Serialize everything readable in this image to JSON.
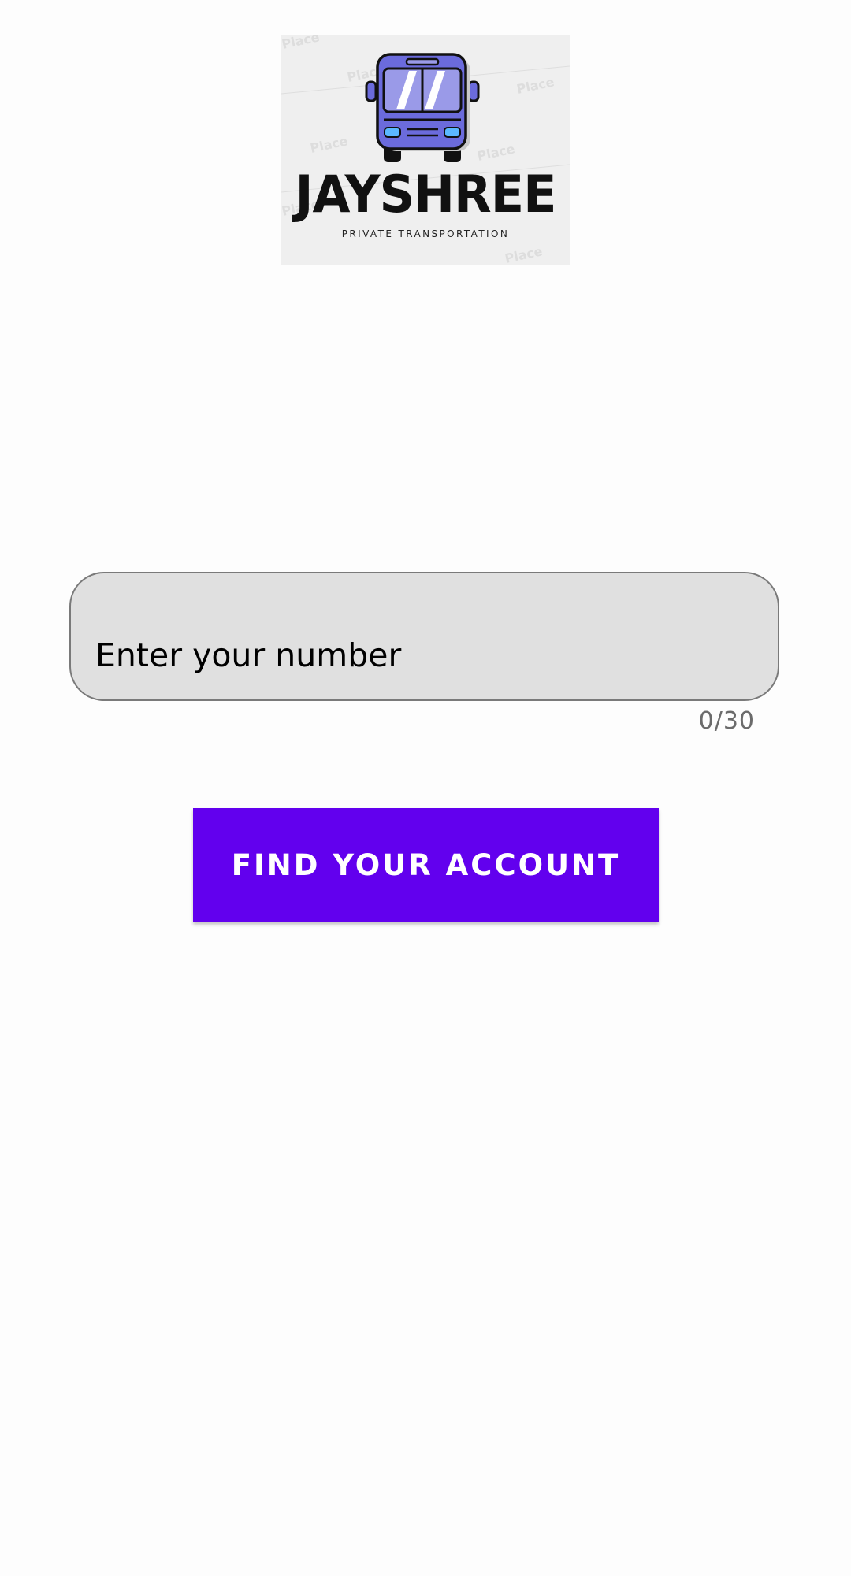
{
  "logo": {
    "brand_name": "JAYSHREE",
    "tagline": "PRIVATE TRANSPORTATION",
    "watermark_text": "Place",
    "icon": "bus-icon",
    "bus_body_color": "#6b6bdc",
    "bus_window_color": "#9a9ae8",
    "headlight_color": "#5bb8ff"
  },
  "form": {
    "number_input": {
      "placeholder": "Enter your number",
      "value": ""
    },
    "counter": "0/30",
    "submit_label": "FIND YOUR ACCOUNT"
  },
  "colors": {
    "accent": "#6200ee",
    "field_background": "#e0e0e0",
    "field_border": "#7a7a7a"
  }
}
